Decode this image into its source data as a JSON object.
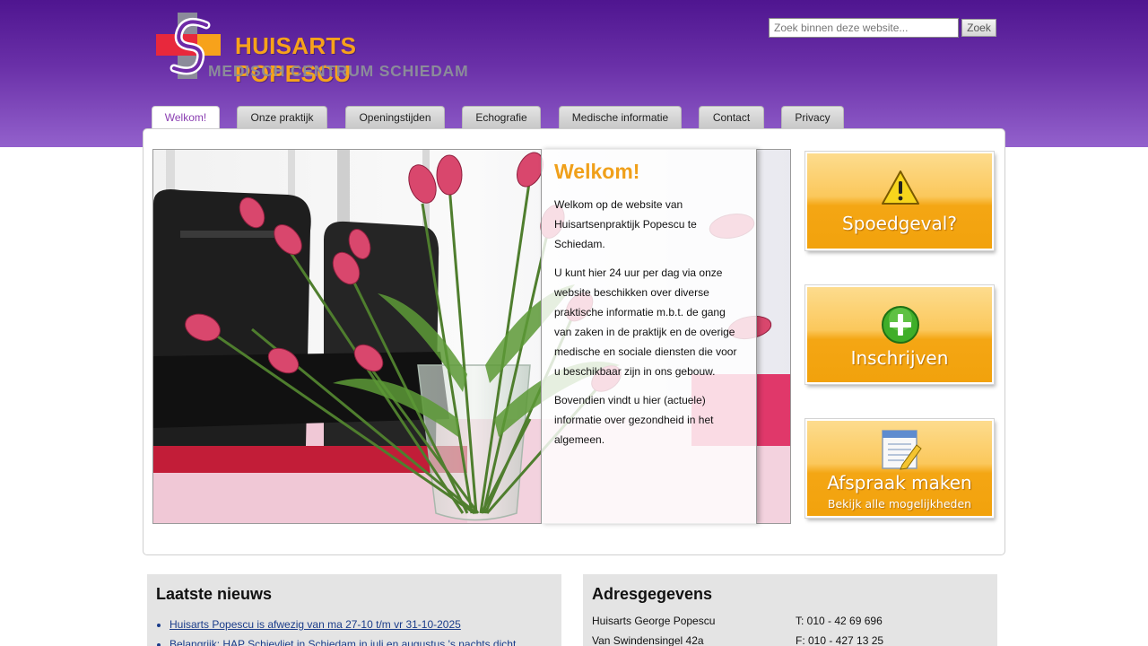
{
  "header": {
    "logo_title": "HUISARTS POPESCU",
    "logo_subtitle": "MEDISCH CENTRUM SCHIEDAM",
    "brand_colors": {
      "purple": "#4f1590",
      "orange": "#f7a21b",
      "red": "#e8283c",
      "grey": "#8b8b9a"
    }
  },
  "search": {
    "placeholder": "Zoek binnen deze website...",
    "button_label": "Zoek"
  },
  "nav": {
    "tabs": [
      {
        "label": "Welkom!",
        "active": true
      },
      {
        "label": "Onze praktijk"
      },
      {
        "label": "Openingstijden"
      },
      {
        "label": "Echografie"
      },
      {
        "label": "Medische informatie"
      },
      {
        "label": "Contact"
      },
      {
        "label": "Privacy"
      }
    ]
  },
  "welcome": {
    "title": "Welkom!",
    "paragraphs": [
      "Welkom op de website van Huisartsenpraktijk Popescu te Schiedam.",
      "U kunt hier 24 uur per dag via onze website beschikken over diverse praktische informatie m.b.t. de gang van zaken in de praktijk en de overige medische en sociale diensten die voor u beschikbaar zijn in ons gebouw.",
      "Bovendien vindt u hier (actuele) informatie over gezondheid in het algemeen."
    ]
  },
  "side_buttons": [
    {
      "label": "Spoedgeval?",
      "icon": "warning-icon"
    },
    {
      "label": "Inschrijven",
      "icon": "plus-icon"
    },
    {
      "label": "Afspraak maken",
      "sublabel": "Bekijk alle mogelijkheden",
      "icon": "notepad-icon"
    }
  ],
  "news": {
    "title": "Laatste nieuws",
    "items": [
      "Huisarts Popescu is afwezig van ma 27-10 t/m vr 31-10-2025",
      "Belangrijk: HAP Schievliet in Schiedam in juli en augustus 's nachts dicht"
    ]
  },
  "address": {
    "title": "Adresgegevens",
    "name": "Huisarts George Popescu",
    "street": "Van Swindensingel 42a",
    "phone": "T: 010 - 42 69 696",
    "fax": "F: 010 - 427 13 25"
  }
}
